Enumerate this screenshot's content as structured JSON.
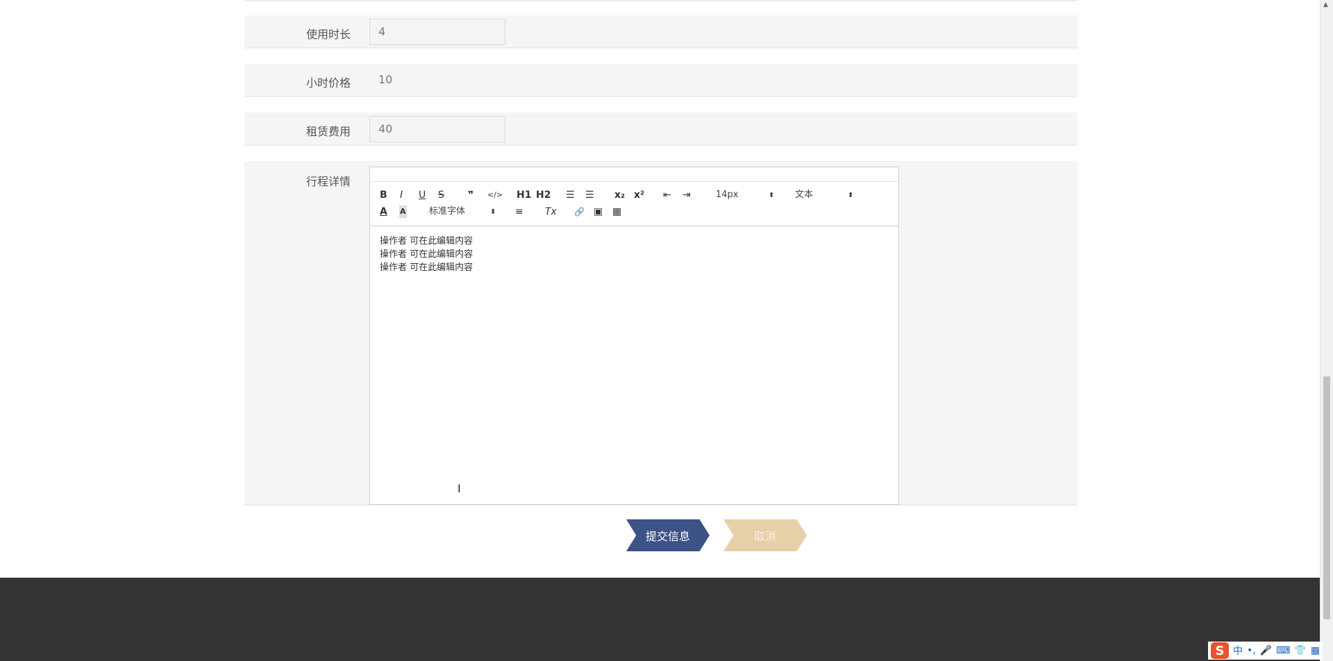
{
  "form": {
    "usage_duration": {
      "label": "使用时长",
      "value": "4"
    },
    "hourly_price": {
      "label": "小时价格",
      "value": "10"
    },
    "rental_fee": {
      "label": "租赁费用",
      "value": "40"
    },
    "trip_details": {
      "label": "行程详情",
      "toolbar": {
        "bold": "B",
        "italic": "I",
        "underline": "U",
        "strike": "S",
        "quote": "❞",
        "code": "</>",
        "h1": "H1",
        "h2": "H2",
        "ordered_list": "☰",
        "bullet_list": "☰",
        "subscript": "x₂",
        "superscript": "x²",
        "outdent": "⇤",
        "indent": "⇥",
        "font_size": "14px",
        "header_select": "文本",
        "font_color": "A",
        "background": "A",
        "font_family": "标准字体",
        "align": "≡",
        "clean": "Tx",
        "link": "🔗",
        "image": "▣",
        "video": "▦"
      },
      "content_lines": [
        "操作者  可在此编辑内容",
        "操作者  可在此编辑内容",
        "操作者  可在此编辑内容"
      ]
    }
  },
  "buttons": {
    "submit": "提交信息",
    "cancel": "取消"
  },
  "ime": {
    "lang": "中",
    "punct": "•,",
    "mic": "🎤",
    "keyboard": "⌨",
    "shirt": "👕",
    "grid": "▦"
  }
}
